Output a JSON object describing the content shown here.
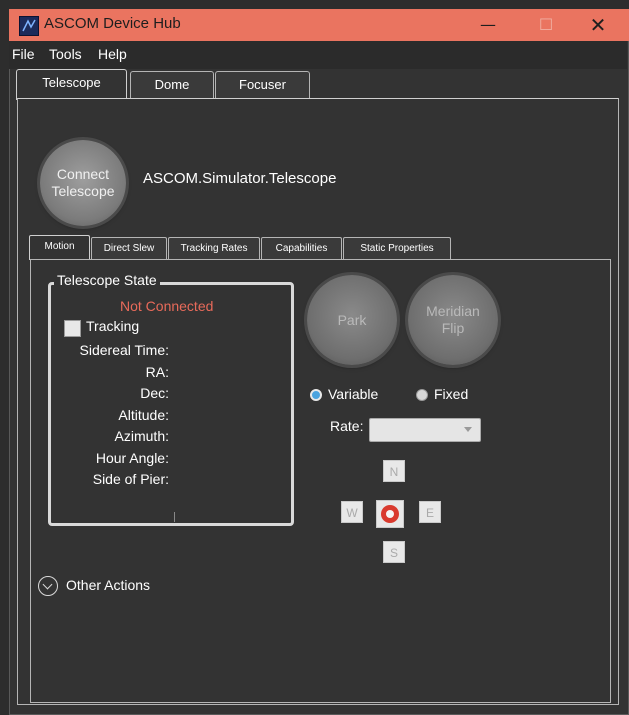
{
  "window": {
    "title": "ASCOM Device Hub",
    "controls": {
      "minimize": "—",
      "maximize": "☐",
      "close": "✕"
    }
  },
  "menu": [
    "File",
    "Tools",
    "Help"
  ],
  "tabs": [
    {
      "label": "Telescope",
      "active": true
    },
    {
      "label": "Dome",
      "active": false
    },
    {
      "label": "Focuser",
      "active": false
    }
  ],
  "connect": {
    "button_label": "Connect Telescope",
    "device_name": "ASCOM.Simulator.Telescope"
  },
  "subtabs": [
    {
      "label": "Motion",
      "active": true
    },
    {
      "label": "Direct Slew",
      "active": false
    },
    {
      "label": "Tracking Rates",
      "active": false
    },
    {
      "label": "Capabilities",
      "active": false
    },
    {
      "label": "Static Properties",
      "active": false
    }
  ],
  "telescope_state": {
    "title": "Telescope State",
    "status": "Not Connected",
    "tracking_label": "Tracking",
    "tracking_checked": false,
    "fields": [
      "Sidereal Time:",
      "RA:",
      "Dec:",
      "Altitude:",
      "Azimuth:",
      "Hour Angle:",
      "Side of Pier:"
    ]
  },
  "actions": {
    "park_label": "Park",
    "meridian_flip_label": "Meridian Flip"
  },
  "slew": {
    "variable_label": "Variable",
    "fixed_label": "Fixed",
    "selected": "Variable",
    "rate_label": "Rate:",
    "rate_value": "",
    "directions": {
      "north": "N",
      "south": "S",
      "east": "E",
      "west": "W"
    }
  },
  "other_actions_label": "Other Actions",
  "colors": {
    "titlebar": "#ea7460",
    "background": "#333333",
    "status_error": "#e86a5a",
    "radio_selected": "#4aa3df",
    "stop": "#d93a2e"
  }
}
